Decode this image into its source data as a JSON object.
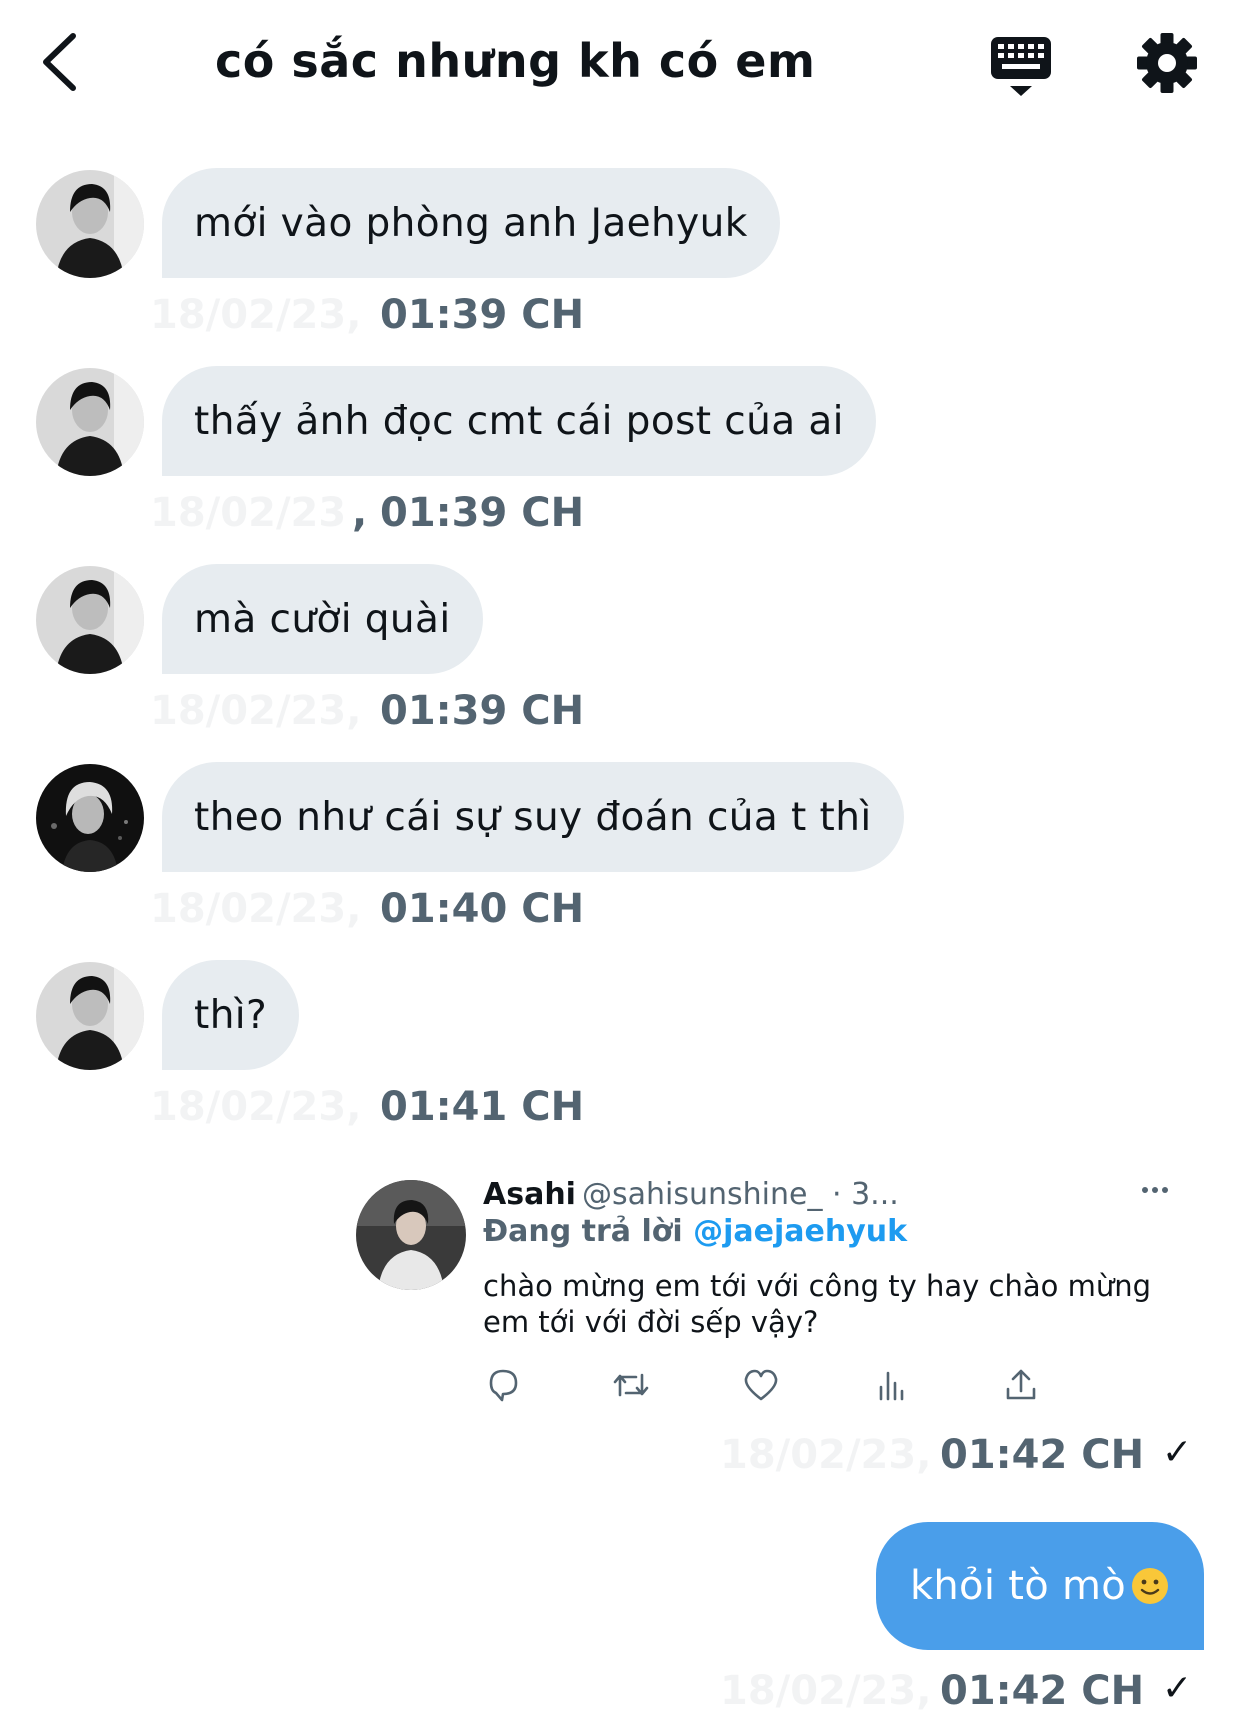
{
  "header": {
    "title": "có sắc nhưng kh có em"
  },
  "messages": [
    {
      "text": "mới vào phòng anh Jaehyuk",
      "date_faded": "18/02/23,",
      "time": "01:39 CH",
      "avatar": "avatar-sender"
    },
    {
      "text": "thấy ảnh đọc cmt cái post của ai",
      "date_faded": "18/02/23",
      "separator": ",",
      "time": "01:39 CH",
      "avatar": "avatar-sender"
    },
    {
      "text": "mà cười quài",
      "date_faded": "18/02/23,",
      "time": "01:39 CH",
      "avatar": "avatar-sender"
    },
    {
      "text": "theo như cái sự suy đoán của t thì",
      "date_faded": "18/02/23,",
      "time": "01:40 CH",
      "avatar": "avatar-me"
    },
    {
      "text": "thì?",
      "date_faded": "18/02/23,",
      "time": "01:41 CH",
      "avatar": "avatar-sender"
    }
  ],
  "tweet": {
    "name": "Asahi",
    "handle": "@sahisunshine_ · 3...",
    "more_icon": "more-horizontal-icon",
    "reply_prefix": "Đang trả lời",
    "reply_mention": "@jaejaehyuk",
    "text": "chào mừng em tới với công ty hay chào mừng em tới với đời sếp vậy?",
    "actions": [
      "reply-icon",
      "retweet-icon",
      "like-icon",
      "views-icon",
      "share-icon"
    ],
    "date_faded": "18/02/23,",
    "time": "01:42 CH",
    "status": "✓"
  },
  "sent": {
    "text": "khỏi tò mò",
    "emoji": "slightly-smiling-face-icon",
    "date_faded": "18/02/23,",
    "time": "01:42 CH",
    "status": "✓"
  },
  "colors": {
    "bubble_in": "#e7ecf0",
    "bubble_out": "#4a9eea",
    "muted": "#536471",
    "mention": "#1d9bf0"
  }
}
